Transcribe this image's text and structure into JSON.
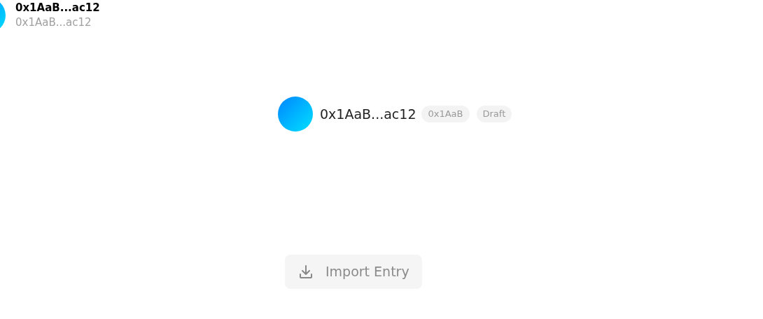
{
  "header_account": {
    "name": "0x1AaB...ac12",
    "address": "0x1AaB...ac12"
  },
  "account": {
    "name": "0x1AaB...ac12",
    "tags": [
      "0x1AaB",
      "Draft"
    ]
  },
  "import_button": {
    "label": "Import Entry",
    "disabled": true
  }
}
